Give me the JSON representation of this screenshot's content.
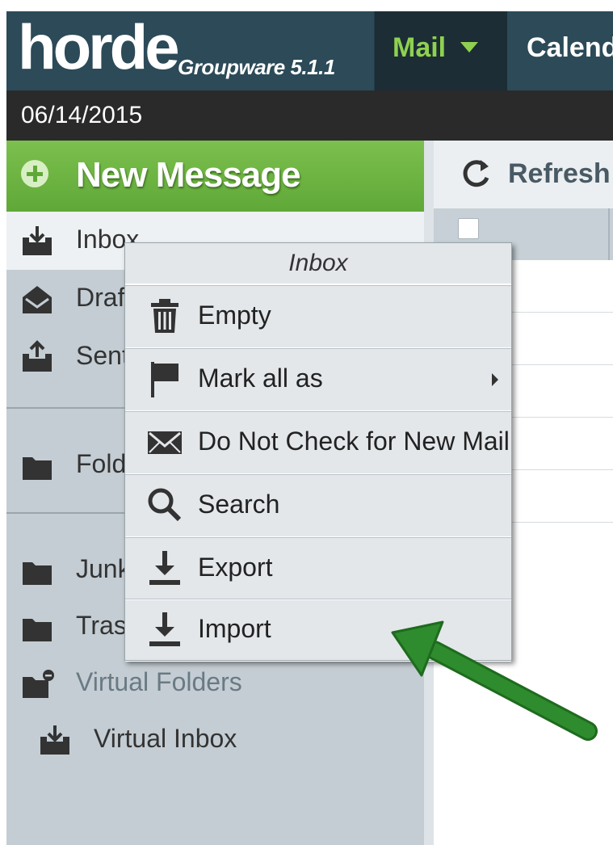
{
  "header": {
    "logo_text": "horde",
    "logo_subtitle": "Groupware 5.1.1",
    "tabs": [
      {
        "label": "Mail",
        "active": true
      },
      {
        "label": "Calendar",
        "active": false
      }
    ],
    "date": "06/14/2015"
  },
  "sidebar": {
    "new_message_label": "New Message",
    "inbox_label": "Inbox",
    "drafts_label": "Drafts",
    "sent_label": "Sent",
    "folders_label": "Folders",
    "junk_label": "Junk",
    "trash_label": "Trash",
    "virtual_folders_label": "Virtual Folders",
    "virtual_inbox_label": "Virtual Inbox"
  },
  "toolbar": {
    "refresh_label": "Refresh"
  },
  "context_menu": {
    "title": "Inbox",
    "items": [
      {
        "label": "Empty",
        "icon": "trash-icon"
      },
      {
        "label": "Mark all as",
        "icon": "flag-icon",
        "has_submenu": true
      },
      {
        "label": "Do Not Check for New Mail",
        "icon": "envelope-icon"
      },
      {
        "label": "Search",
        "icon": "search-icon"
      },
      {
        "label": "Export",
        "icon": "download-icon"
      },
      {
        "label": "Import",
        "icon": "download-icon"
      }
    ]
  },
  "colors": {
    "accent_green": "#8fd14f",
    "new_message_green": "#6cb443",
    "header_dark": "#243b48",
    "annotation_arrow": "#2e8b2e"
  }
}
